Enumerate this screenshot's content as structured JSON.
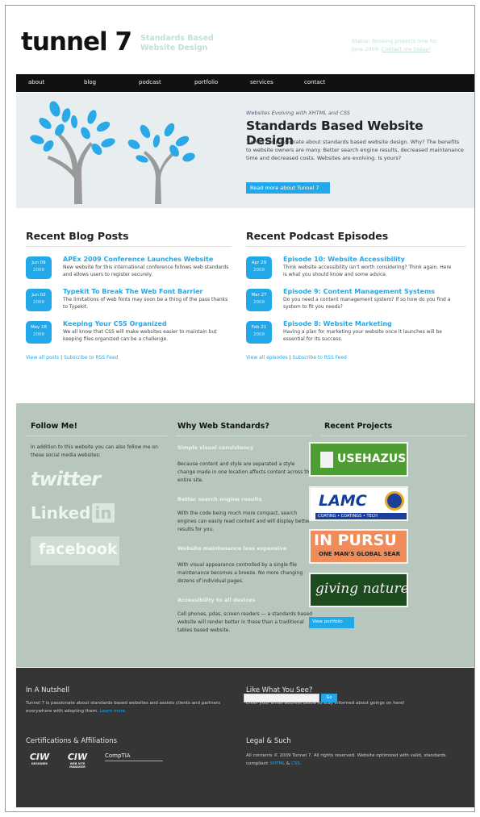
{
  "header": {
    "logo": "tunnel 7",
    "tagline": "Standards Based Website Design",
    "status_text": "Status: Booking projects now for June 2009.",
    "status_link": "Contact me today!"
  },
  "nav": [
    "about",
    "blog",
    "podcast",
    "portfolio",
    "services",
    "contact"
  ],
  "hero": {
    "eyebrow": "Websites Evolving with XHTML and CSS",
    "title": "Standards Based Website Design",
    "text": "Tunnel 7 is passionate about standards based website design. Why? The benefits to website owners are many. Better search engine results, decreased maintenance time and decreased costs. Websites are evolving. Is yours?",
    "button": "Read more about Tunnel 7"
  },
  "blog": {
    "title": "Recent Blog Posts",
    "posts": [
      {
        "month": "Jun 09",
        "year": "2009",
        "title": "APEx 2009 Conference Launches Website",
        "text": "New website for this international conference follows web standards and allows users to register securely."
      },
      {
        "month": "Jun 02",
        "year": "2009",
        "title": "Typekit To Break The Web Font Barrier",
        "text": "The limitations of web fonts may soon be a thing of the pass thanks to Typekit."
      },
      {
        "month": "May 18",
        "year": "2009",
        "title": "Keeping Your CSS Organized",
        "text": "We all know that CSS will make websites easier to maintain but keeping files organized can be a challenge."
      }
    ],
    "view_all": "View all posts",
    "sep": "|",
    "rss": "Subscribe to RSS Feed"
  },
  "podcast": {
    "title": "Recent Podcast Episodes",
    "episodes": [
      {
        "month": "Apr 29",
        "year": "2009",
        "title": "Episode 10: Website Accessibility",
        "text": "Think website accessibility isn't worth considering? Think again. Here is what you should know and some advice."
      },
      {
        "month": "Mar 27",
        "year": "2009",
        "title": "Episode 9: Content Management Systems",
        "text": "Do you need a content management system? If so how do you find a system to fit you needs?"
      },
      {
        "month": "Feb 21",
        "year": "2009",
        "title": "Episode 8: Website Marketing",
        "text": "Having a plan for marketing your website once it launches will be essential for its success."
      }
    ],
    "view_all": "View all episodes",
    "sep": "|",
    "rss": "Subscribe to RSS Feed"
  },
  "follow": {
    "title": "Follow Me!",
    "text": "In addition to this website you can also follow me on these social media websites:",
    "twitter": "twitter",
    "linkedin_a": "Linked",
    "linkedin_b": "in",
    "facebook": "facebook"
  },
  "why": {
    "title": "Why Web Standards?",
    "points": [
      {
        "h": "Simple visual consistency",
        "t": "Because content and style are separated a style change made in one location affects content across the entire site."
      },
      {
        "h": "Better search engine results",
        "t": "With the code being much more compact, search engines can easily read content and will display better results for you."
      },
      {
        "h": "Website maintenance less expensive",
        "t": "With visual appearance controlled by a single file maintenance becomes a breeze. No more changing dozens of individual pages."
      },
      {
        "h": "Accessibility to all devices",
        "t": "Cell phones, pdas, screen readers — a standards based website will render better in these than a traditional tables based website."
      }
    ]
  },
  "projects": {
    "title": "Recent Projects",
    "p1": "USEHAZUS",
    "p2": "LAMC",
    "p2_sub": "COATING • COATINGS • TECH",
    "p3a": "IN PURSU",
    "p3b": "ONE MAN'S GLOBAL SEAR",
    "p4": "giving nature",
    "button": "View portfolio"
  },
  "footer": {
    "nutshell_title": "In A Nutshell",
    "nutshell_text": "Tunnel 7 is passionate about standards based websites and assists clients and partners everywhere with adopting them.",
    "nutshell_link": "Learn more.",
    "like_title": "Like What You See?",
    "like_text": "Enter your email address below to stay informed about goings on here!",
    "go": "Go",
    "cert_title": "Certifications & Affiliations",
    "ciw1": "CIW",
    "ciw1_sub": "DESIGNER",
    "ciw2": "CIW",
    "ciw2_sub": "WEB SITE MANAGER",
    "comptia": "CompTIA",
    "legal_title": "Legal & Such",
    "legal_text": "All contents © 2009 Tunnel 7. All rights reserved. Website optimized with valid, standards compliant",
    "legal_x": "XHTML",
    "legal_amp": "&",
    "legal_c": "CSS."
  }
}
